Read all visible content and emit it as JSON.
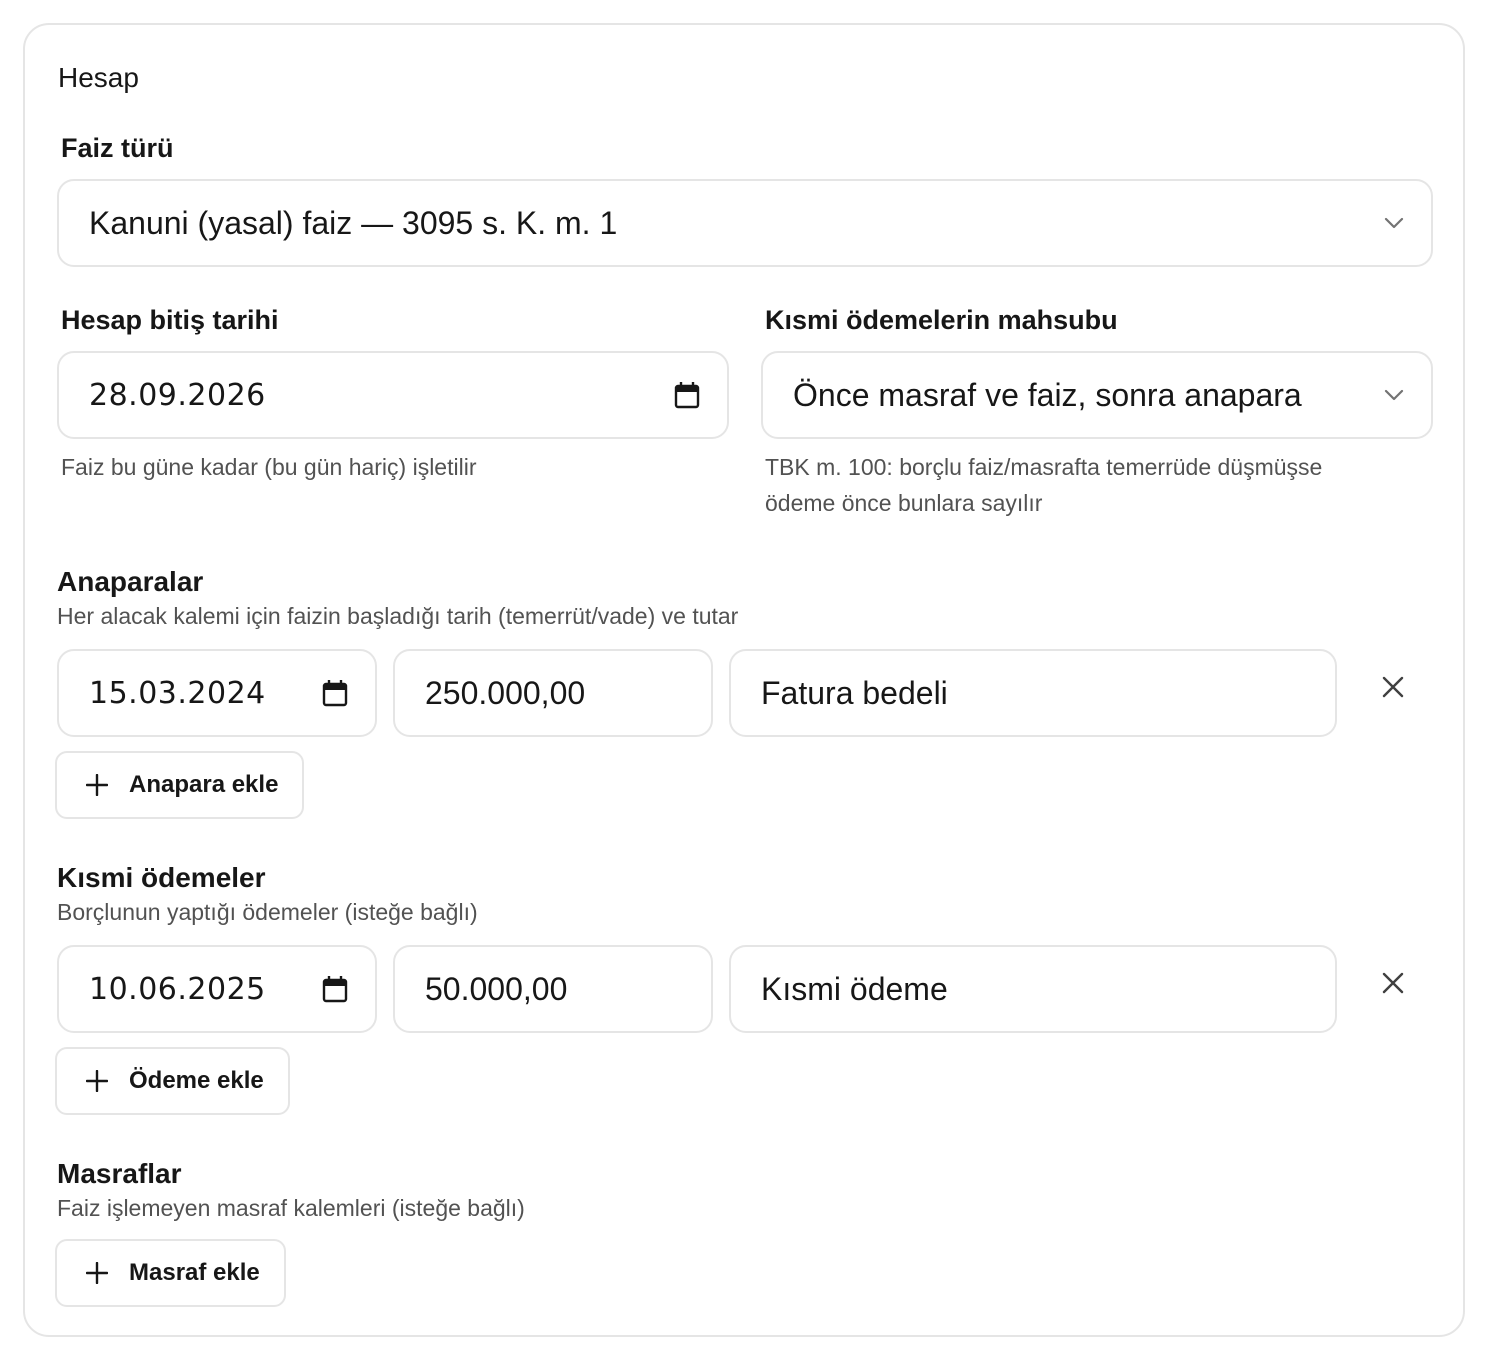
{
  "card": {
    "title": "Hesap"
  },
  "interest_type": {
    "label": "Faiz türü",
    "value": "Kanuni (yasal) faiz — 3095 s. K. m. 1",
    "icon": "chevron-down-icon"
  },
  "end_date": {
    "label": "Hesap bitiş tarihi",
    "value": "28.09.2026",
    "hint": "Faiz bu güne kadar (bu gün hariç) işletilir",
    "icon": "calendar-icon"
  },
  "offset": {
    "label": "Kısmi ödemelerin mahsubu",
    "value": "Önce masraf ve faiz, sonra anapara",
    "hint_line1": "TBK m. 100: borçlu faiz/masrafta temerrüde düşmüşse",
    "hint_line2": "ödeme önce bunlara sayılır",
    "icon": "chevron-down-icon"
  },
  "principals": {
    "title": "Anaparalar",
    "description": "Her alacak kalemi için faizin başladığı tarih (temerrüt/vade) ve tutar",
    "rows": [
      {
        "date": "15.03.2024",
        "amount": "250.000,00",
        "note": "Fatura bedeli"
      }
    ],
    "add_label": "Anapara ekle"
  },
  "payments": {
    "title": "Kısmi ödemeler",
    "description": "Borçlunun yaptığı ödemeler (isteğe bağlı)",
    "rows": [
      {
        "date": "10.06.2025",
        "amount": "50.000,00",
        "note": "Kısmi ödeme"
      }
    ],
    "add_label": "Ödeme ekle"
  },
  "expenses": {
    "title": "Masraflar",
    "description": "Faiz işlemeyen masraf kalemleri (isteğe bağlı)",
    "add_label": "Masraf ekle"
  },
  "colors": {
    "border": "#e5e5e5",
    "text": "#171717",
    "muted": "#525252"
  }
}
